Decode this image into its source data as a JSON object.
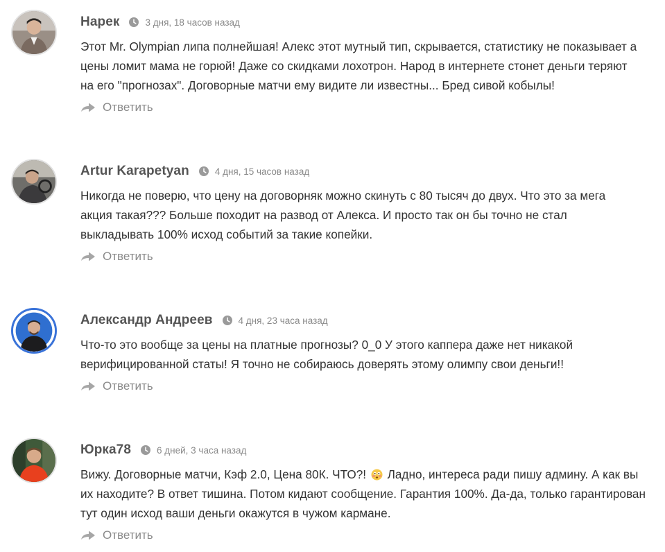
{
  "comments": [
    {
      "author": "Нарек",
      "time": "3 дня, 18 часов назад",
      "text": "Этот Mr. Olympian липа полнейшая! Алекс этот мутный тип, скрывается, статистику не показывает а\nцены ломит мама не горюй! Даже со скидками лохотрон. Народ в интернете стонет деньги теряют\nна его \"прогнозах\". Договорные матчи ему видите ли известны... Бред сивой кобылы!",
      "reply_label": "Ответить"
    },
    {
      "author": "Artur Karapetyan",
      "time": "4 дня, 15 часов назад",
      "text": "Никогда не поверю, что цену на договорняк можно скинуть с 80 тысяч до двух. Что это за мега\nакция такая??? Больше походит на развод от Алекса. И просто так он бы точно не стал\nвыкладывать 100% исход событий за такие копейки.",
      "reply_label": "Ответить"
    },
    {
      "author": "Александр Андреев",
      "time": "4 дня, 23 часа назад",
      "text": "Что-то это вообще за цены на платные прогнозы? 0_0 У этого каппера даже нет никакой\nверифицированной статы! Я точно не собираюсь доверять этому олимпу свои деньги!!",
      "reply_label": "Ответить"
    },
    {
      "author": "Юрка78",
      "time": "6 дней, 3 часа назад",
      "text_before_emoji": "Вижу. Договорные матчи, Кэф 2.0, Цена 80К. ЧТО?! ",
      "emoji": "flushed-face-emoji",
      "text_after_emoji": " Ладно, интереса ради пишу админу. А как вы\nих находите? В ответ тишина. Потом кидают сообщение. Гарантия 100%. Да-да, только гарантирован\nтут один исход ваши деньги окажутся в чужом кармане.",
      "reply_label": "Ответить"
    }
  ],
  "icons": {
    "time": "clock-icon",
    "reply": "reply-arrow-icon"
  },
  "colors": {
    "author": "#555555",
    "meta": "#8a8a8a",
    "text": "#333333",
    "avatar_ring_blue": "#3a73d9"
  }
}
